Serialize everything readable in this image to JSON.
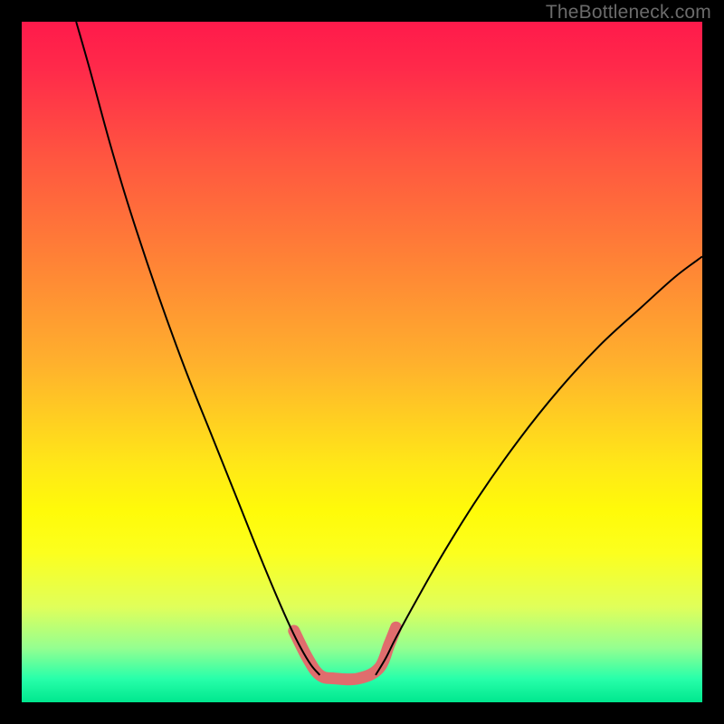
{
  "watermark": {
    "text": "TheBottleneck.com"
  },
  "chart_data": {
    "type": "line",
    "title": "",
    "xlabel": "",
    "ylabel": "",
    "xlim": [
      0,
      100
    ],
    "ylim": [
      0,
      100
    ],
    "grid": false,
    "legend": false,
    "background_gradient": {
      "stops": [
        {
          "offset": 0.0,
          "color": "#ff1a4b"
        },
        {
          "offset": 0.07,
          "color": "#ff2a4a"
        },
        {
          "offset": 0.2,
          "color": "#ff5640"
        },
        {
          "offset": 0.35,
          "color": "#ff8236"
        },
        {
          "offset": 0.5,
          "color": "#ffb02d"
        },
        {
          "offset": 0.65,
          "color": "#ffe718"
        },
        {
          "offset": 0.72,
          "color": "#fffb09"
        },
        {
          "offset": 0.78,
          "color": "#fcff1e"
        },
        {
          "offset": 0.86,
          "color": "#e0ff5a"
        },
        {
          "offset": 0.92,
          "color": "#95ff90"
        },
        {
          "offset": 0.965,
          "color": "#28ffaa"
        },
        {
          "offset": 1.0,
          "color": "#00e78e"
        }
      ]
    },
    "series": [
      {
        "name": "left-curve",
        "color": "#000000",
        "width": 2,
        "points": [
          {
            "x": 8.0,
            "y": 100.0
          },
          {
            "x": 10.0,
            "y": 93.0
          },
          {
            "x": 13.0,
            "y": 82.0
          },
          {
            "x": 16.0,
            "y": 72.0
          },
          {
            "x": 20.0,
            "y": 60.0
          },
          {
            "x": 24.0,
            "y": 49.0
          },
          {
            "x": 28.0,
            "y": 39.0
          },
          {
            "x": 32.0,
            "y": 29.0
          },
          {
            "x": 35.0,
            "y": 21.5
          },
          {
            "x": 37.5,
            "y": 15.5
          },
          {
            "x": 39.5,
            "y": 11.0
          },
          {
            "x": 41.0,
            "y": 8.0
          },
          {
            "x": 42.5,
            "y": 5.5
          },
          {
            "x": 43.8,
            "y": 4.0
          }
        ]
      },
      {
        "name": "right-curve",
        "color": "#000000",
        "width": 2,
        "points": [
          {
            "x": 52.0,
            "y": 4.0
          },
          {
            "x": 53.5,
            "y": 6.5
          },
          {
            "x": 55.0,
            "y": 9.5
          },
          {
            "x": 58.0,
            "y": 15.0
          },
          {
            "x": 62.0,
            "y": 22.0
          },
          {
            "x": 67.0,
            "y": 30.0
          },
          {
            "x": 73.0,
            "y": 38.5
          },
          {
            "x": 79.0,
            "y": 46.0
          },
          {
            "x": 85.0,
            "y": 52.5
          },
          {
            "x": 91.0,
            "y": 58.0
          },
          {
            "x": 96.0,
            "y": 62.5
          },
          {
            "x": 100.0,
            "y": 65.5
          }
        ]
      },
      {
        "name": "highlight-segment",
        "color": "#e06d6d",
        "width": 13,
        "linecap": "round",
        "points": [
          {
            "x": 40.0,
            "y": 10.5
          },
          {
            "x": 42.0,
            "y": 6.5
          },
          {
            "x": 43.8,
            "y": 4.0
          },
          {
            "x": 46.0,
            "y": 3.5
          },
          {
            "x": 49.5,
            "y": 3.5
          },
          {
            "x": 52.5,
            "y": 5.0
          },
          {
            "x": 54.0,
            "y": 8.5
          },
          {
            "x": 55.0,
            "y": 11.0
          }
        ]
      }
    ]
  }
}
